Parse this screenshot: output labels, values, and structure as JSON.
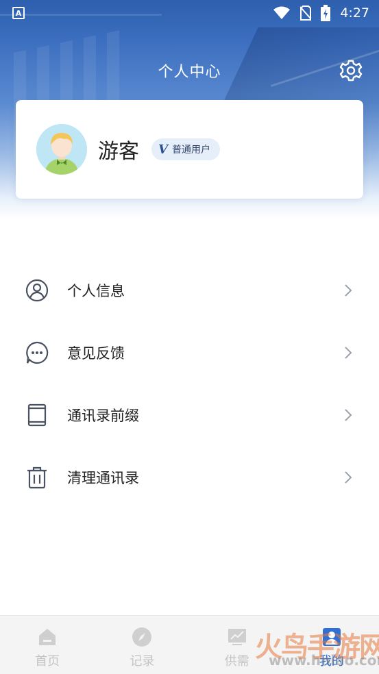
{
  "status_bar": {
    "app_icon_letter": "A",
    "time": "4:27"
  },
  "header": {
    "title": "个人中心"
  },
  "profile": {
    "username": "游客",
    "badge_icon": "V",
    "badge_label": "普通用户"
  },
  "menu": {
    "items": [
      {
        "label": "个人信息",
        "icon": "user-circle-icon"
      },
      {
        "label": "意见反馈",
        "icon": "chat-bubble-icon"
      },
      {
        "label": "通讯录前缀",
        "icon": "tablet-icon"
      },
      {
        "label": "清理通讯录",
        "icon": "trash-icon"
      }
    ]
  },
  "tab_bar": {
    "tabs": [
      {
        "label": "首页",
        "icon": "home-icon",
        "active": false
      },
      {
        "label": "记录",
        "icon": "compass-icon",
        "active": false
      },
      {
        "label": "供需",
        "icon": "trend-chart-icon",
        "active": false
      },
      {
        "label": "我的",
        "icon": "profile-icon",
        "active": true
      }
    ]
  },
  "watermark": {
    "text": "火鸟手游网",
    "url": "www.hniao.com"
  },
  "colors": {
    "header_blue": "#2d5fae",
    "accent_blue": "#2f6fd6",
    "badge_bg": "#e6eef9",
    "tab_inactive": "#c4c4c4"
  }
}
